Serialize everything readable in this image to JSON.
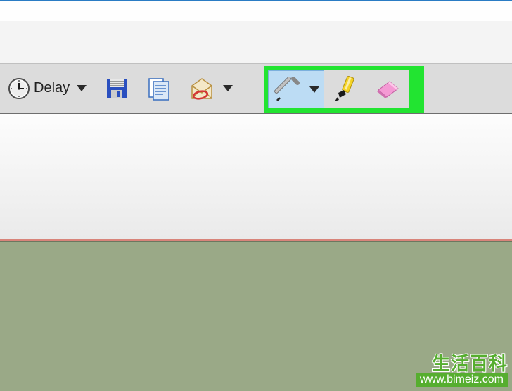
{
  "toolbar": {
    "delay_label": "Delay",
    "icons": {
      "clock": "clock-icon",
      "save": "save-icon",
      "copy": "copy-icon",
      "mail": "mail-icon",
      "pen": "pen-icon",
      "highlighter": "highlighter-icon",
      "eraser": "eraser-icon"
    }
  },
  "watermark": {
    "title": "生活百科",
    "url": "www.bimeiz.com"
  }
}
